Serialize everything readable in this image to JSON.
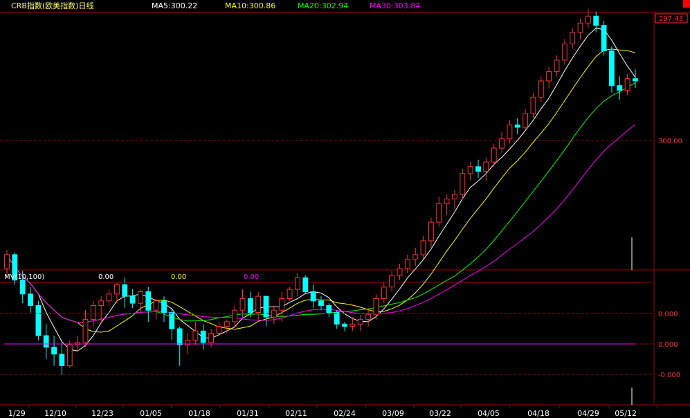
{
  "header": {
    "title": "CRB指数(欧美指数)日线",
    "ma5_label": "MA5:300.22",
    "ma10_label": "MA10:300.86",
    "ma20_label": "MA20:302.94",
    "ma30_label": "MA30:303.84"
  },
  "price_scale": {
    "top_tag": "297.43",
    "level_300": "300.00"
  },
  "indicator": {
    "label": "MV(10,100)",
    "v1": "0.00",
    "v2": "0.00",
    "v3": "0.00",
    "ticks": [
      "0.000",
      "0.000",
      "-0.000"
    ]
  },
  "dates": [
    "1/29",
    "12/10",
    "12/23",
    "01/05",
    "01/18",
    "01/31",
    "02/11",
    "02/24",
    "03/09",
    "03/22",
    "04/05",
    "04/18",
    "04/29",
    "05/12"
  ],
  "colors": {
    "up": "#ff3232",
    "down": "#00ffff",
    "ma5": "#ffffff",
    "ma10": "#ffff00",
    "ma20": "#00ff00",
    "ma30": "#ff00ff",
    "grid": "#a00000",
    "header_title": "#ffff66"
  },
  "chart_data": {
    "type": "candlestick",
    "ylim": [
      292,
      303
    ],
    "series": [
      {
        "name": "CRB指数(欧美指数)日线",
        "ohlc": [
          [
            292.0,
            292.8,
            291.6,
            292.6
          ],
          [
            292.6,
            292.7,
            291.3,
            291.5
          ],
          [
            291.5,
            291.9,
            290.5,
            290.9
          ],
          [
            290.9,
            291.2,
            290.1,
            290.4
          ],
          [
            290.4,
            290.6,
            288.9,
            289.1
          ],
          [
            289.1,
            289.6,
            288.1,
            288.6
          ],
          [
            288.6,
            289.1,
            287.8,
            288.3
          ],
          [
            288.3,
            288.8,
            287.4,
            287.8
          ],
          [
            287.8,
            288.9,
            287.7,
            288.7
          ],
          [
            288.7,
            289.1,
            288.5,
            288.8
          ],
          [
            288.8,
            290.2,
            288.6,
            289.8
          ],
          [
            289.8,
            290.6,
            289.5,
            290.4
          ],
          [
            290.4,
            290.8,
            289.6,
            290.6
          ],
          [
            290.6,
            291.1,
            290.4,
            290.9
          ],
          [
            290.9,
            291.4,
            290.5,
            291.3
          ],
          [
            291.3,
            291.6,
            290.3,
            290.8
          ],
          [
            290.8,
            291.1,
            290.3,
            290.5
          ],
          [
            290.5,
            291.1,
            290.1,
            291.0
          ],
          [
            291.0,
            291.2,
            289.7,
            290.2
          ],
          [
            290.2,
            290.7,
            289.8,
            290.6
          ],
          [
            290.6,
            290.8,
            289.7,
            290.1
          ],
          [
            290.1,
            290.3,
            288.9,
            289.4
          ],
          [
            289.4,
            289.5,
            287.8,
            288.7
          ],
          [
            288.7,
            289.2,
            288.3,
            288.9
          ],
          [
            288.9,
            289.7,
            288.7,
            289.3
          ],
          [
            289.3,
            289.6,
            288.5,
            288.8
          ],
          [
            288.8,
            289.4,
            288.6,
            289.2
          ],
          [
            289.2,
            289.7,
            289.1,
            289.5
          ],
          [
            289.5,
            289.8,
            289.2,
            289.7
          ],
          [
            289.7,
            290.4,
            289.5,
            290.2
          ],
          [
            290.2,
            291.1,
            289.9,
            290.7
          ],
          [
            290.7,
            291.0,
            289.9,
            290.1
          ],
          [
            290.1,
            291.0,
            289.8,
            290.8
          ],
          [
            290.8,
            290.8,
            289.5,
            289.9
          ],
          [
            289.9,
            290.4,
            289.6,
            290.2
          ],
          [
            290.2,
            291.0,
            289.7,
            290.7
          ],
          [
            290.7,
            291.2,
            290.6,
            291.1
          ],
          [
            291.1,
            291.8,
            290.8,
            291.6
          ],
          [
            291.6,
            291.7,
            290.9,
            291.0
          ],
          [
            291.0,
            291.3,
            290.3,
            290.6
          ],
          [
            290.6,
            290.8,
            290.2,
            290.4
          ],
          [
            290.4,
            290.5,
            289.9,
            290.1
          ],
          [
            290.1,
            290.2,
            289.4,
            289.6
          ],
          [
            289.6,
            289.7,
            289.3,
            289.5
          ],
          [
            289.5,
            289.9,
            289.3,
            289.6
          ],
          [
            289.6,
            290.0,
            289.3,
            289.8
          ],
          [
            289.8,
            290.3,
            289.5,
            290.0
          ],
          [
            290.0,
            290.9,
            289.8,
            290.7
          ],
          [
            290.7,
            291.4,
            290.5,
            291.2
          ],
          [
            291.2,
            291.9,
            291.0,
            291.7
          ],
          [
            291.7,
            292.2,
            291.5,
            292.0
          ],
          [
            292.0,
            292.6,
            291.8,
            292.4
          ],
          [
            292.4,
            292.9,
            292.1,
            292.6
          ],
          [
            292.6,
            293.4,
            292.4,
            293.2
          ],
          [
            293.2,
            294.2,
            292.9,
            294.0
          ],
          [
            294.0,
            295.1,
            293.8,
            294.8
          ],
          [
            294.8,
            295.2,
            294.3,
            295.0
          ],
          [
            295.0,
            295.4,
            294.6,
            295.2
          ],
          [
            295.2,
            296.3,
            295.0,
            296.1
          ],
          [
            296.1,
            296.6,
            295.8,
            296.4
          ],
          [
            296.4,
            296.7,
            295.9,
            296.2
          ],
          [
            296.2,
            296.8,
            295.8,
            296.6
          ],
          [
            296.6,
            297.4,
            296.4,
            297.2
          ],
          [
            297.2,
            297.9,
            297.0,
            297.6
          ],
          [
            297.6,
            298.4,
            297.4,
            298.2
          ],
          [
            298.2,
            298.5,
            297.8,
            298.1
          ],
          [
            298.1,
            298.9,
            298.0,
            298.7
          ],
          [
            298.7,
            299.6,
            298.5,
            299.4
          ],
          [
            299.4,
            300.3,
            299.2,
            300.1
          ],
          [
            300.1,
            300.7,
            299.8,
            300.5
          ],
          [
            300.5,
            301.2,
            300.3,
            301.0
          ],
          [
            301.0,
            301.9,
            300.8,
            301.7
          ],
          [
            301.7,
            302.4,
            301.5,
            302.2
          ],
          [
            302.2,
            302.8,
            301.9,
            302.6
          ],
          [
            302.6,
            303.2,
            302.4,
            302.9
          ],
          [
            302.9,
            303.1,
            302.2,
            302.5
          ],
          [
            302.5,
            302.7,
            301.2,
            301.4
          ],
          [
            301.4,
            301.6,
            299.6,
            299.9
          ],
          [
            299.9,
            300.3,
            299.3,
            299.7
          ],
          [
            299.7,
            300.4,
            299.5,
            300.2
          ],
          [
            300.2,
            300.6,
            299.8,
            300.1
          ]
        ]
      },
      {
        "name": "MA5",
        "values": []
      },
      {
        "name": "MA10",
        "values": []
      },
      {
        "name": "MA20",
        "values": []
      },
      {
        "name": "MA30",
        "values": []
      }
    ]
  }
}
